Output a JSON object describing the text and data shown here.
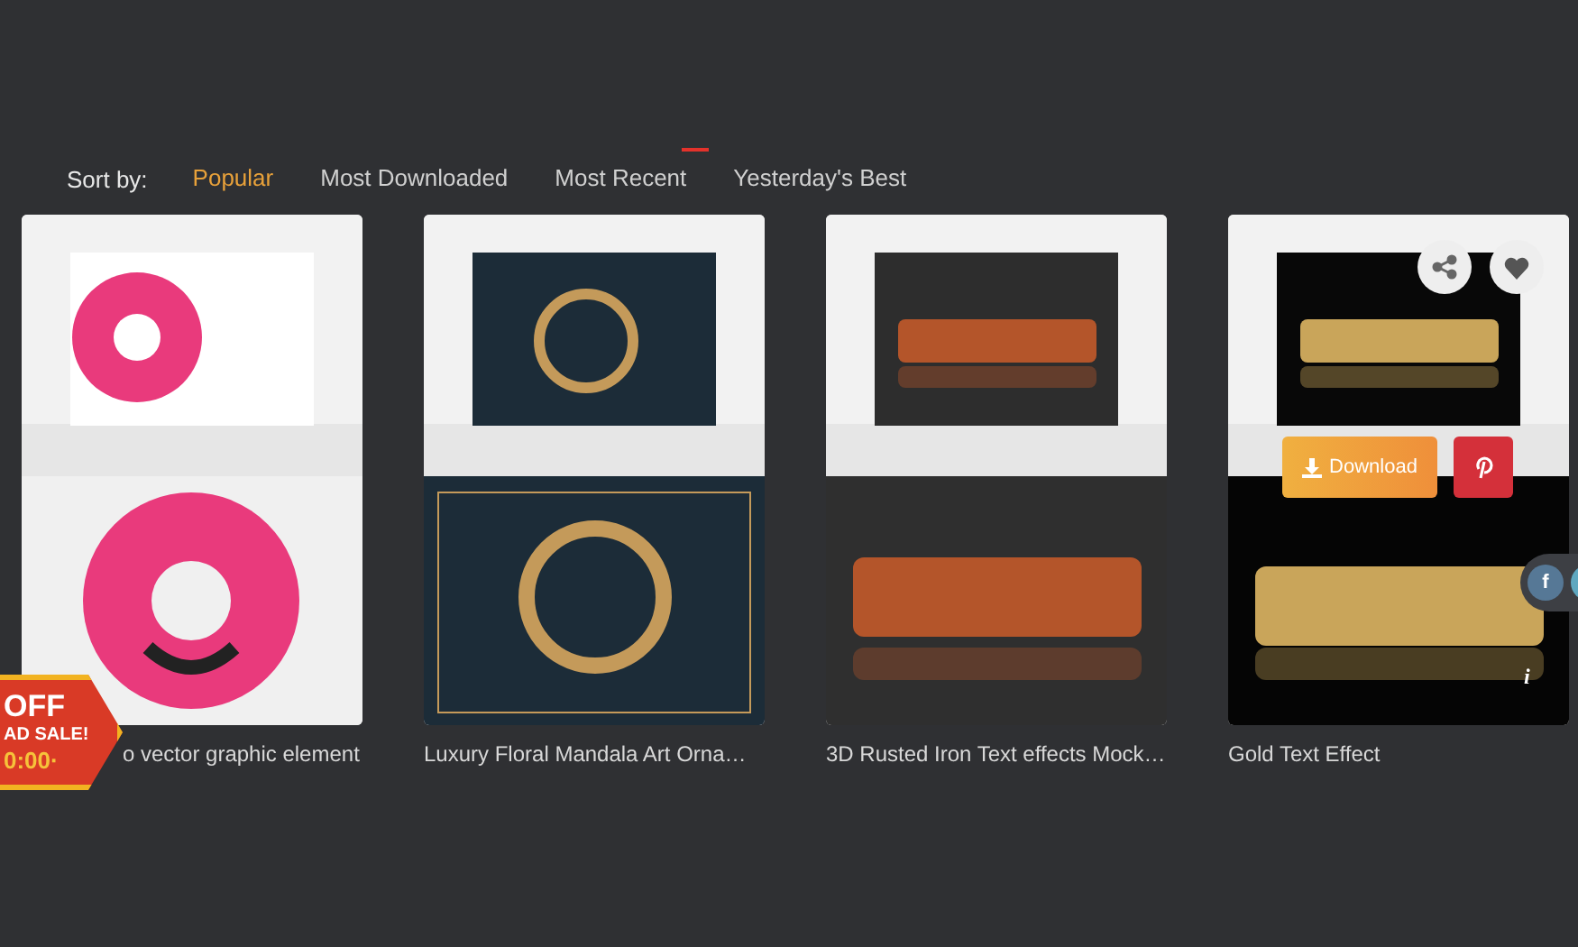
{
  "sort_bar": {
    "label": "Sort by:",
    "options": [
      {
        "label": "Popular",
        "selected": true,
        "flagged": false
      },
      {
        "label": "Most Downloaded",
        "selected": false,
        "flagged": false
      },
      {
        "label": "Most Recent",
        "selected": false,
        "flagged": true
      },
      {
        "label": "Yesterday's Best",
        "selected": false,
        "flagged": false
      }
    ]
  },
  "cards": [
    {
      "title": "o vector graphic element",
      "hovered": false
    },
    {
      "title": "Luxury Floral Mandala Art Orna…",
      "hovered": false
    },
    {
      "title": "3D Rusted Iron Text effects Mock…",
      "hovered": false
    },
    {
      "title": "Gold Text Effect",
      "hovered": true
    }
  ],
  "hover_actions": {
    "download": "Download",
    "info": "i",
    "social": "f"
  },
  "sale_badge": {
    "lines": [
      "OFF",
      "AD SALE!",
      "0:00·"
    ]
  }
}
